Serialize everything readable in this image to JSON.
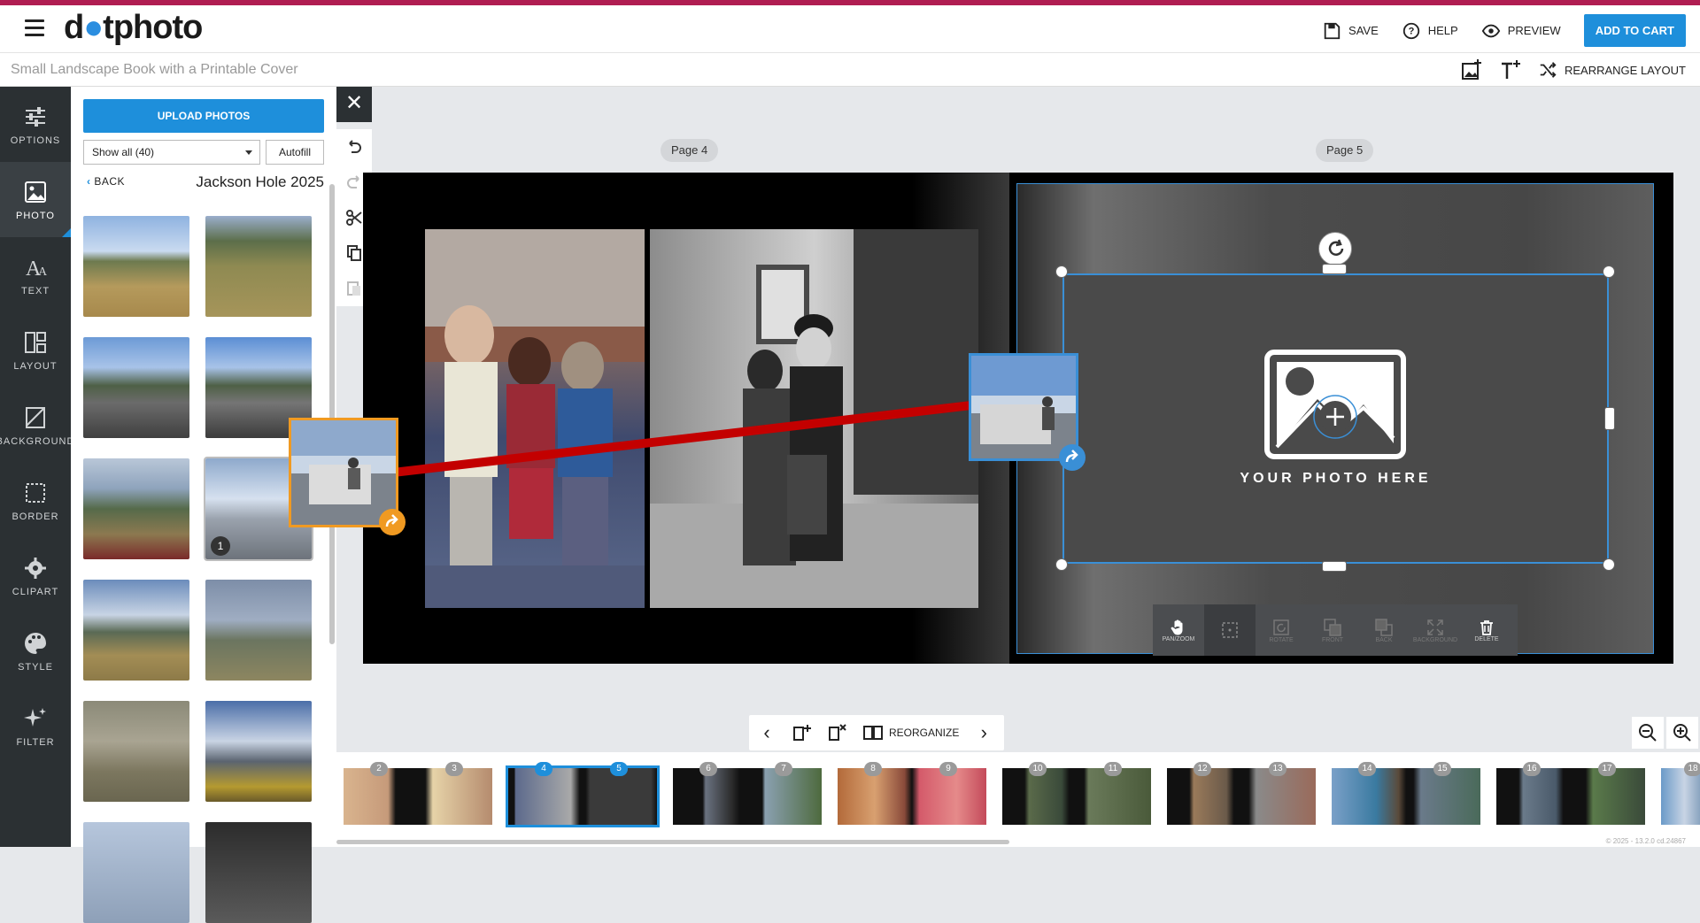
{
  "app": {
    "logo_text": "dotphoto",
    "logo_first": "d",
    "logo_rest": "tphoto",
    "colors": {
      "brand_stripe": "#b01d52",
      "accent": "#1e8fdb",
      "drag_orange": "#f09a22"
    }
  },
  "header": {
    "save_label": "SAVE",
    "help_label": "HELP",
    "preview_label": "PREVIEW",
    "cart_label": "ADD TO CART"
  },
  "subbar": {
    "project_title": "Small Landscape Book with a Printable Cover",
    "rearrange_label": "REARRANGE LAYOUT",
    "icons": [
      "add-photo-icon",
      "add-text-icon",
      "shuffle-icon"
    ]
  },
  "leftnav": {
    "items": [
      {
        "label": "OPTIONS",
        "icon": "sliders-icon"
      },
      {
        "label": "PHOTO",
        "icon": "photo-icon",
        "active": true
      },
      {
        "label": "TEXT",
        "icon": "text-icon"
      },
      {
        "label": "LAYOUT",
        "icon": "layout-icon"
      },
      {
        "label": "BACKGROUND",
        "icon": "background-icon"
      },
      {
        "label": "BORDER",
        "icon": "border-icon"
      },
      {
        "label": "CLIPART",
        "icon": "clipart-icon"
      },
      {
        "label": "STYLE",
        "icon": "palette-icon"
      },
      {
        "label": "FILTER",
        "icon": "sparkle-icon"
      }
    ]
  },
  "photopanel": {
    "upload_label": "UPLOAD PHOTOS",
    "filter_value": "Show all (40)",
    "autofill_label": "Autofill",
    "back_label": "BACK",
    "album_title": "Jackson Hole 2025",
    "selected_badge": "1"
  },
  "canvas": {
    "page_left_label": "Page 4",
    "page_right_label": "Page 5",
    "placeholder_text": "YOUR PHOTO HERE",
    "toolbar": [
      {
        "label": "PAN/ZOOM",
        "icon": "hand-icon",
        "enabled": true
      },
      {
        "label": "",
        "icon": "crop-icon",
        "enabled": true
      },
      {
        "label": "ROTATE",
        "icon": "rotate-icon",
        "enabled": false
      },
      {
        "label": "FRONT",
        "icon": "front-icon",
        "enabled": false
      },
      {
        "label": "BACK",
        "icon": "back-icon",
        "enabled": false
      },
      {
        "label": "BACKGROUND",
        "icon": "expand-icon",
        "enabled": false
      },
      {
        "label": "DELETE",
        "icon": "trash-icon",
        "enabled": true
      }
    ]
  },
  "bottom_controls": {
    "reorganize_label": "REORGANIZE"
  },
  "filmstrip": {
    "spreads": [
      {
        "left": "2",
        "right": "3"
      },
      {
        "left": "4",
        "right": "5",
        "active": true
      },
      {
        "left": "6",
        "right": "7"
      },
      {
        "left": "8",
        "right": "9"
      },
      {
        "left": "10",
        "right": "11"
      },
      {
        "left": "12",
        "right": "13"
      },
      {
        "left": "14",
        "right": "15"
      },
      {
        "left": "16",
        "right": "17"
      },
      {
        "left": "18",
        "right": ""
      }
    ]
  },
  "footer": {
    "version": "© 2025 - 13.2.0 cd.24867"
  }
}
